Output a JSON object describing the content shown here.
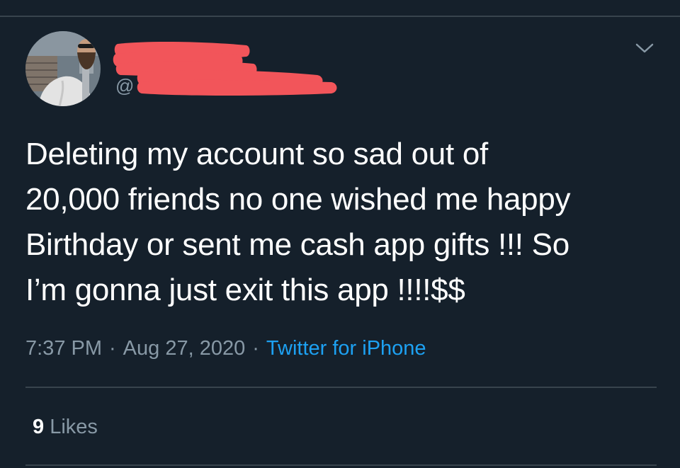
{
  "tweet": {
    "author": {
      "handle_prefix": "@"
    },
    "text": "Deleting my account so sad out of\n20,000 friends no one wished me happy\nBirthday or sent me cash app gifts !!! So\nI’m gonna just exit this app !!!!$$",
    "time": "7:37 PM",
    "separator": "·",
    "date": "Aug 27, 2020",
    "source": "Twitter for iPhone",
    "likes_count": "9",
    "likes_label": "Likes"
  },
  "icons": {
    "menu": "chevron-down-icon"
  },
  "colors": {
    "background": "#15202b",
    "text": "#ffffff",
    "secondary": "#8899a6",
    "link": "#1da1f2",
    "divider": "#38444d",
    "redaction": "#f2555a"
  }
}
